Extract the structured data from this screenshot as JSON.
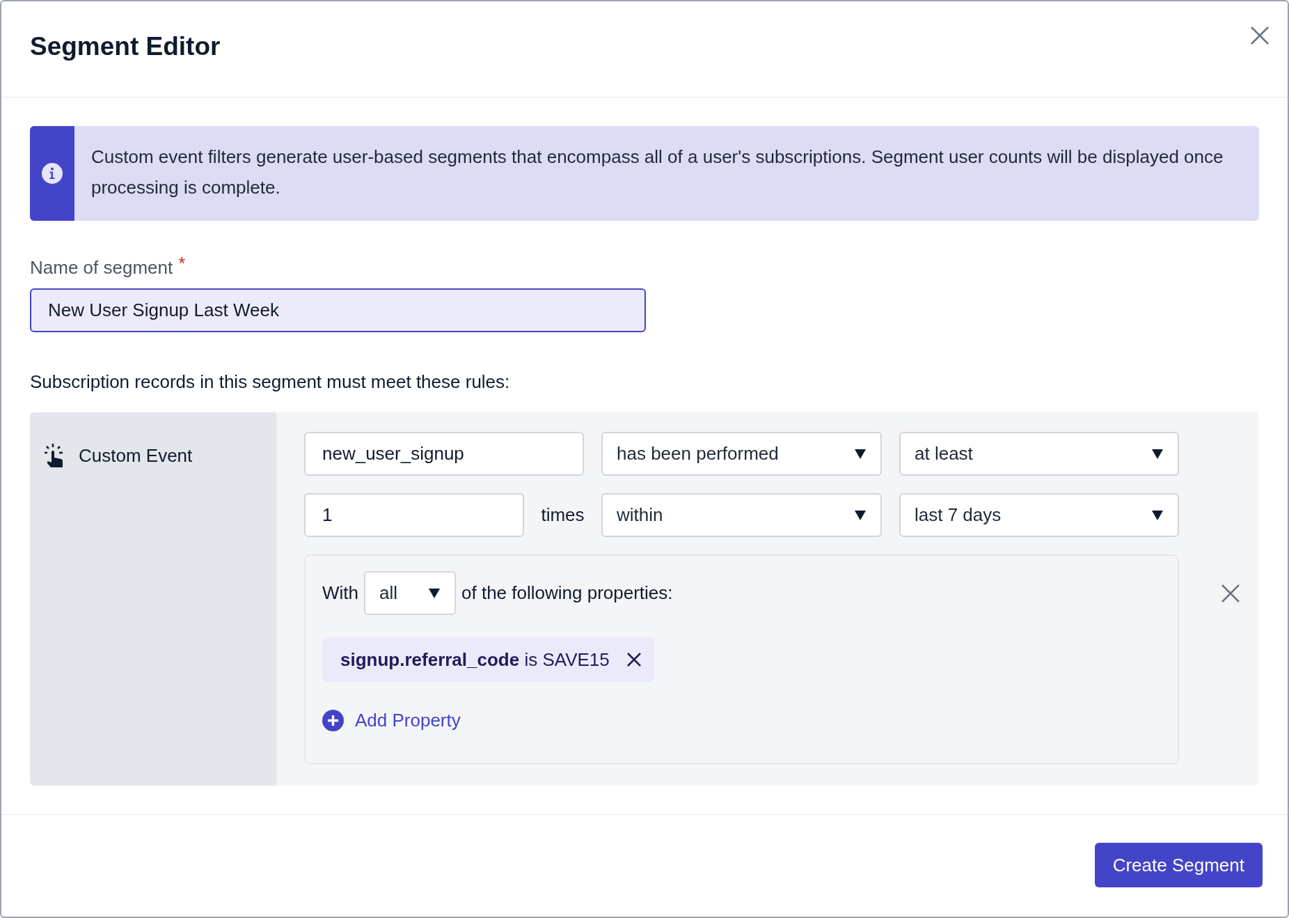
{
  "dialog": {
    "title": "Segment Editor"
  },
  "info_banner": {
    "text": "Custom event filters generate user-based segments that encompass all of a user's subscriptions. Segment user counts will be displayed once processing is complete."
  },
  "name_field": {
    "label": "Name of segment",
    "required_mark": "*",
    "value": "New User Signup Last Week",
    "focused": true
  },
  "rules_heading": "Subscription records in this segment must meet these rules:",
  "rule": {
    "category": "Custom Event",
    "event_name": "new_user_signup",
    "condition": "has been performed",
    "frequency": "at least",
    "count": "1",
    "count_unit": "times",
    "time_operator": "within",
    "time_range": "last 7 days",
    "property_filter": {
      "prefix": "With",
      "match": "all",
      "suffix": "of the following properties:",
      "properties": [
        {
          "text": "**signup.referral_code** is SAVE15"
        }
      ],
      "add_label": "Add Property"
    }
  },
  "footer": {
    "primary_button": "Create Segment"
  }
}
